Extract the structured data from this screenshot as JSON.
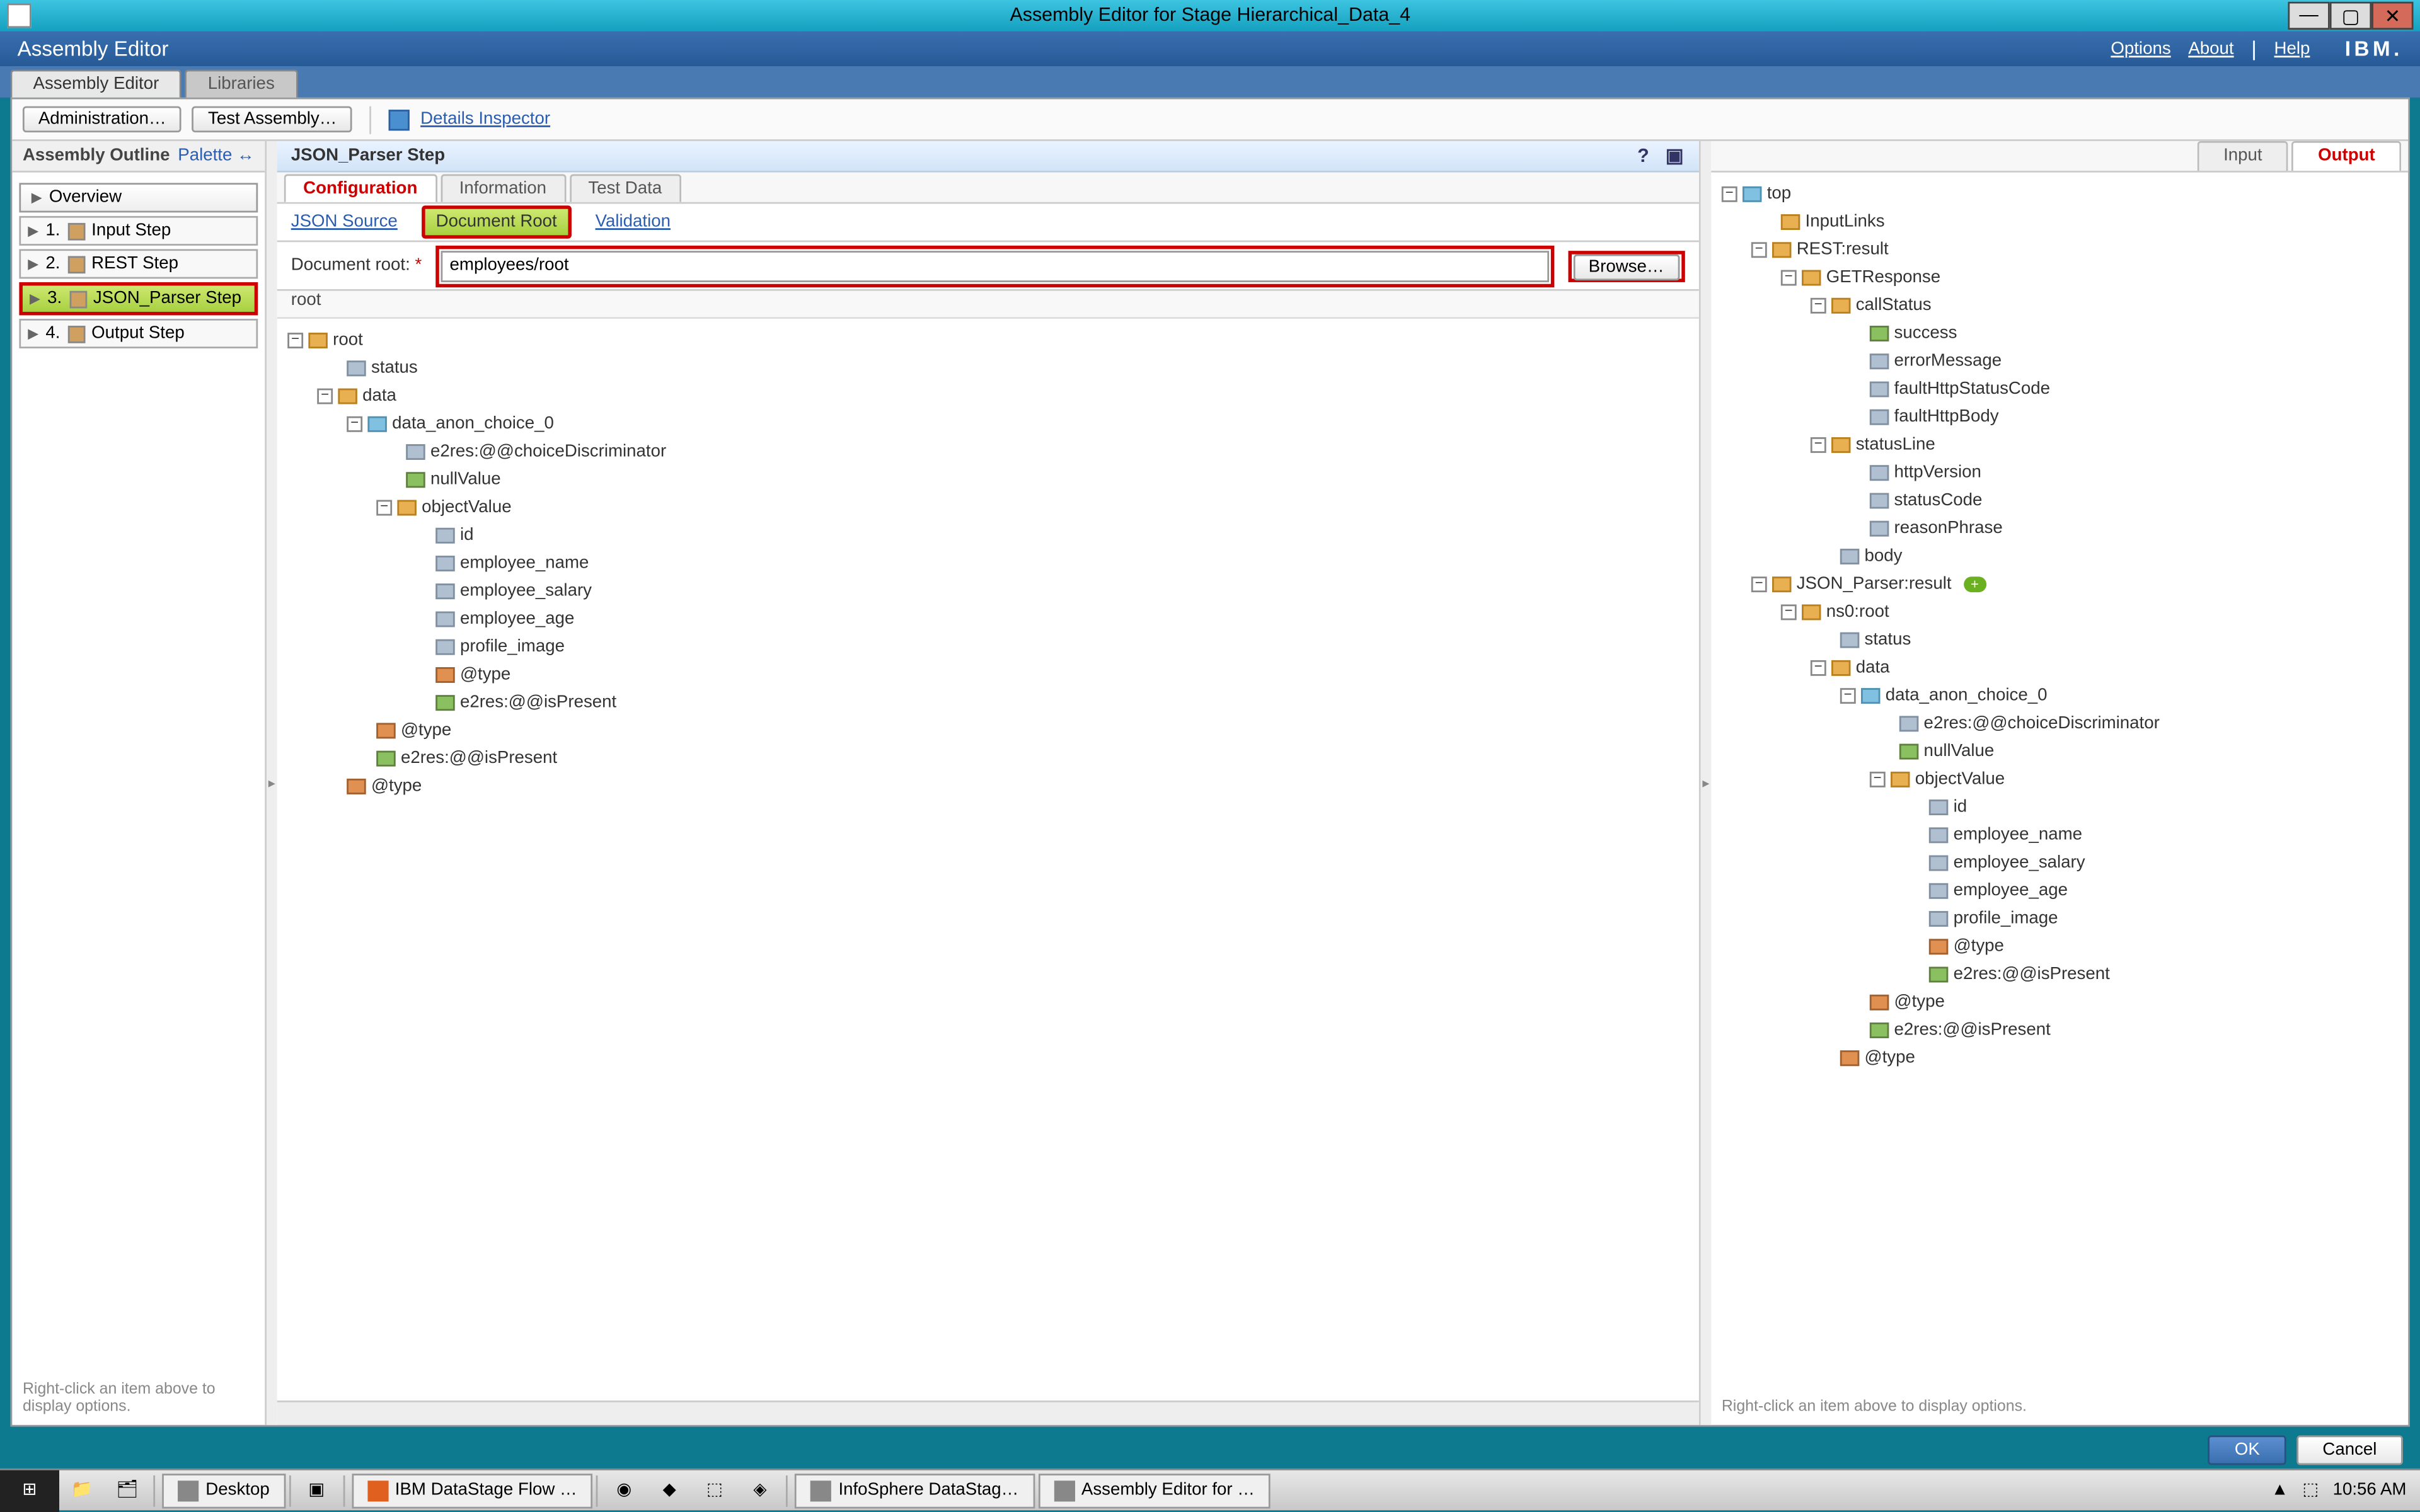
{
  "window": {
    "title": "Assembly Editor for Stage Hierarchical_Data_4"
  },
  "bluebar": {
    "title": "Assembly Editor",
    "options": "Options",
    "about": "About",
    "help": "Help",
    "brand": "IBM."
  },
  "toptabs": {
    "editor": "Assembly Editor",
    "libraries": "Libraries"
  },
  "toolbar": {
    "admin": "Administration…",
    "test": "Test Assembly…",
    "inspector": "Details Inspector"
  },
  "outline": {
    "title": "Assembly Outline",
    "palette": "Palette ↔",
    "overview": "Overview",
    "steps": [
      {
        "num": "1.",
        "label": "Input Step"
      },
      {
        "num": "2.",
        "label": "REST Step"
      },
      {
        "num": "3.",
        "label": "JSON_Parser Step"
      },
      {
        "num": "4.",
        "label": "Output Step"
      }
    ],
    "hint": "Right-click an item above to display options."
  },
  "center": {
    "stepTitle": "JSON_Parser Step",
    "subtabs": {
      "config": "Configuration",
      "info": "Information",
      "test": "Test Data"
    },
    "cfgTabs": {
      "src": "JSON Source",
      "root": "Document Root",
      "val": "Validation"
    },
    "docRootLabel": "Document root:",
    "docRootValue": "employees/root",
    "browse": "Browse…",
    "rootLabel": "root",
    "tree": [
      {
        "d": 0,
        "t": "tg-",
        "i": "folder",
        "l": "root"
      },
      {
        "d": 1,
        "t": "",
        "i": "field",
        "l": "status"
      },
      {
        "d": 1,
        "t": "tg-",
        "i": "folder",
        "l": "data"
      },
      {
        "d": 2,
        "t": "tg-",
        "i": "choice",
        "l": "data_anon_choice_0"
      },
      {
        "d": 3,
        "t": "",
        "i": "field",
        "l": "e2res:@@choiceDiscriminator"
      },
      {
        "d": 3,
        "t": "",
        "i": "null",
        "l": "nullValue"
      },
      {
        "d": 3,
        "t": "tg-",
        "i": "folder",
        "l": "objectValue"
      },
      {
        "d": 4,
        "t": "",
        "i": "field",
        "l": "id"
      },
      {
        "d": 4,
        "t": "",
        "i": "field",
        "l": "employee_name"
      },
      {
        "d": 4,
        "t": "",
        "i": "field",
        "l": "employee_salary"
      },
      {
        "d": 4,
        "t": "",
        "i": "field",
        "l": "employee_age"
      },
      {
        "d": 4,
        "t": "",
        "i": "field",
        "l": "profile_image"
      },
      {
        "d": 4,
        "t": "",
        "i": "attr",
        "l": "@type"
      },
      {
        "d": 4,
        "t": "",
        "i": "null",
        "l": "e2res:@@isPresent"
      },
      {
        "d": 2,
        "t": "",
        "i": "attr",
        "l": "@type"
      },
      {
        "d": 2,
        "t": "",
        "i": "null",
        "l": "e2res:@@isPresent"
      },
      {
        "d": 1,
        "t": "",
        "i": "attr",
        "l": "@type"
      }
    ]
  },
  "right": {
    "input": "Input",
    "output": "Output",
    "hint": "Right-click an item above to display options.",
    "tree": [
      {
        "d": 0,
        "t": "tg-",
        "i": "choice",
        "l": "top"
      },
      {
        "d": 1,
        "t": "",
        "i": "folder",
        "l": "InputLinks"
      },
      {
        "d": 1,
        "t": "tg-",
        "i": "folder",
        "l": "REST:result"
      },
      {
        "d": 2,
        "t": "tg-",
        "i": "folder",
        "l": "GETResponse"
      },
      {
        "d": 3,
        "t": "tg-",
        "i": "folder",
        "l": "callStatus"
      },
      {
        "d": 4,
        "t": "",
        "i": "null",
        "l": "success"
      },
      {
        "d": 4,
        "t": "",
        "i": "field",
        "l": "errorMessage"
      },
      {
        "d": 4,
        "t": "",
        "i": "field",
        "l": "faultHttpStatusCode"
      },
      {
        "d": 4,
        "t": "",
        "i": "field",
        "l": "faultHttpBody"
      },
      {
        "d": 3,
        "t": "tg-",
        "i": "folder",
        "l": "statusLine"
      },
      {
        "d": 4,
        "t": "",
        "i": "field",
        "l": "httpVersion"
      },
      {
        "d": 4,
        "t": "",
        "i": "field",
        "l": "statusCode"
      },
      {
        "d": 4,
        "t": "",
        "i": "field",
        "l": "reasonPhrase"
      },
      {
        "d": 3,
        "t": "",
        "i": "field",
        "l": "body"
      },
      {
        "d": 1,
        "t": "tg-",
        "i": "folder",
        "l": "JSON_Parser:result",
        "badge": "+"
      },
      {
        "d": 2,
        "t": "tg-",
        "i": "folder",
        "l": "ns0:root"
      },
      {
        "d": 3,
        "t": "",
        "i": "field",
        "l": "status"
      },
      {
        "d": 3,
        "t": "tg-",
        "i": "folder",
        "l": "data"
      },
      {
        "d": 4,
        "t": "tg-",
        "i": "choice",
        "l": "data_anon_choice_0"
      },
      {
        "d": 5,
        "t": "",
        "i": "field",
        "l": "e2res:@@choiceDiscriminator"
      },
      {
        "d": 5,
        "t": "",
        "i": "null",
        "l": "nullValue"
      },
      {
        "d": 5,
        "t": "tg-",
        "i": "folder",
        "l": "objectValue"
      },
      {
        "d": 6,
        "t": "",
        "i": "field",
        "l": "id"
      },
      {
        "d": 6,
        "t": "",
        "i": "field",
        "l": "employee_name"
      },
      {
        "d": 6,
        "t": "",
        "i": "field",
        "l": "employee_salary"
      },
      {
        "d": 6,
        "t": "",
        "i": "field",
        "l": "employee_age"
      },
      {
        "d": 6,
        "t": "",
        "i": "field",
        "l": "profile_image"
      },
      {
        "d": 6,
        "t": "",
        "i": "attr",
        "l": "@type"
      },
      {
        "d": 6,
        "t": "",
        "i": "null",
        "l": "e2res:@@isPresent"
      },
      {
        "d": 4,
        "t": "",
        "i": "attr",
        "l": "@type"
      },
      {
        "d": 4,
        "t": "",
        "i": "null",
        "l": "e2res:@@isPresent"
      },
      {
        "d": 3,
        "t": "",
        "i": "attr",
        "l": "@type"
      }
    ]
  },
  "dlg": {
    "ok": "OK",
    "cancel": "Cancel"
  },
  "taskbar": {
    "desktop": "Desktop",
    "tasks": [
      "IBM DataStage Flow …",
      "InfoSphere DataStag…",
      "Assembly Editor for …"
    ],
    "clock": "10:56 AM"
  }
}
